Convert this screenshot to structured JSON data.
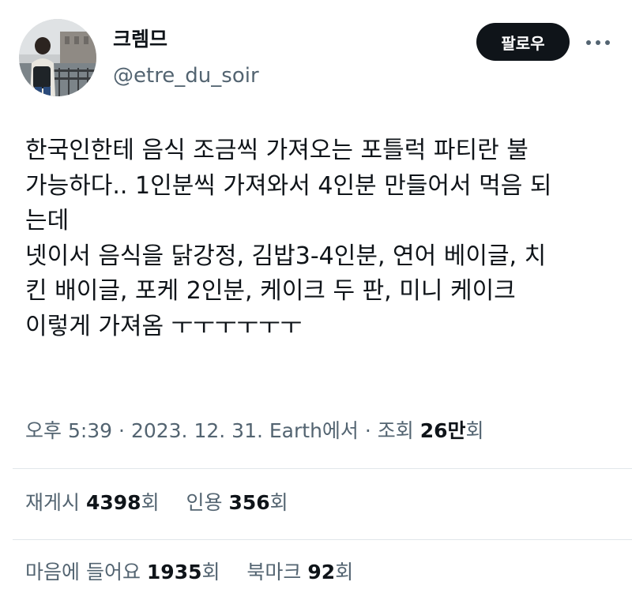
{
  "author": {
    "display_name": "크렘므",
    "handle": "@etre_du_soir"
  },
  "actions": {
    "follow_label": "팔로우",
    "more_icon": "more-horizontal-icon"
  },
  "tweet": {
    "lines": [
      "한국인한테 음식 조금씩 가져오는 포틀럭 파티란 불",
      "가능하다.. 1인분씩 가져와서 4인분 만들어서 먹음 되",
      "는데",
      "넷이서 음식을 닭강정, 김밥3-4인분, 연어 베이글, 치",
      "킨 배이글, 포케 2인분, 케이크 두 판, 미니 케이크",
      "이렇게 가져옴 ㅜㅜㅜㅜㅜㅜ"
    ]
  },
  "meta": {
    "time": "오후 5:39",
    "separator": " · ",
    "date": "2023. 12. 31.",
    "source": "Earth에서",
    "views_label": "조회",
    "views_count": "26만",
    "views_unit": "회"
  },
  "stats": {
    "retweets_label": "재게시",
    "retweets_count": "4398",
    "quotes_label": "인용",
    "quotes_count": "356",
    "likes_label": "마음에 들어요",
    "likes_count": "1935",
    "bookmarks_label": "북마크",
    "bookmarks_count": "92",
    "unit": "회"
  },
  "colors": {
    "text_primary": "#0f1419",
    "text_secondary": "#536471",
    "follow_bg": "#0f1419",
    "divider": "#e1e6ea"
  }
}
